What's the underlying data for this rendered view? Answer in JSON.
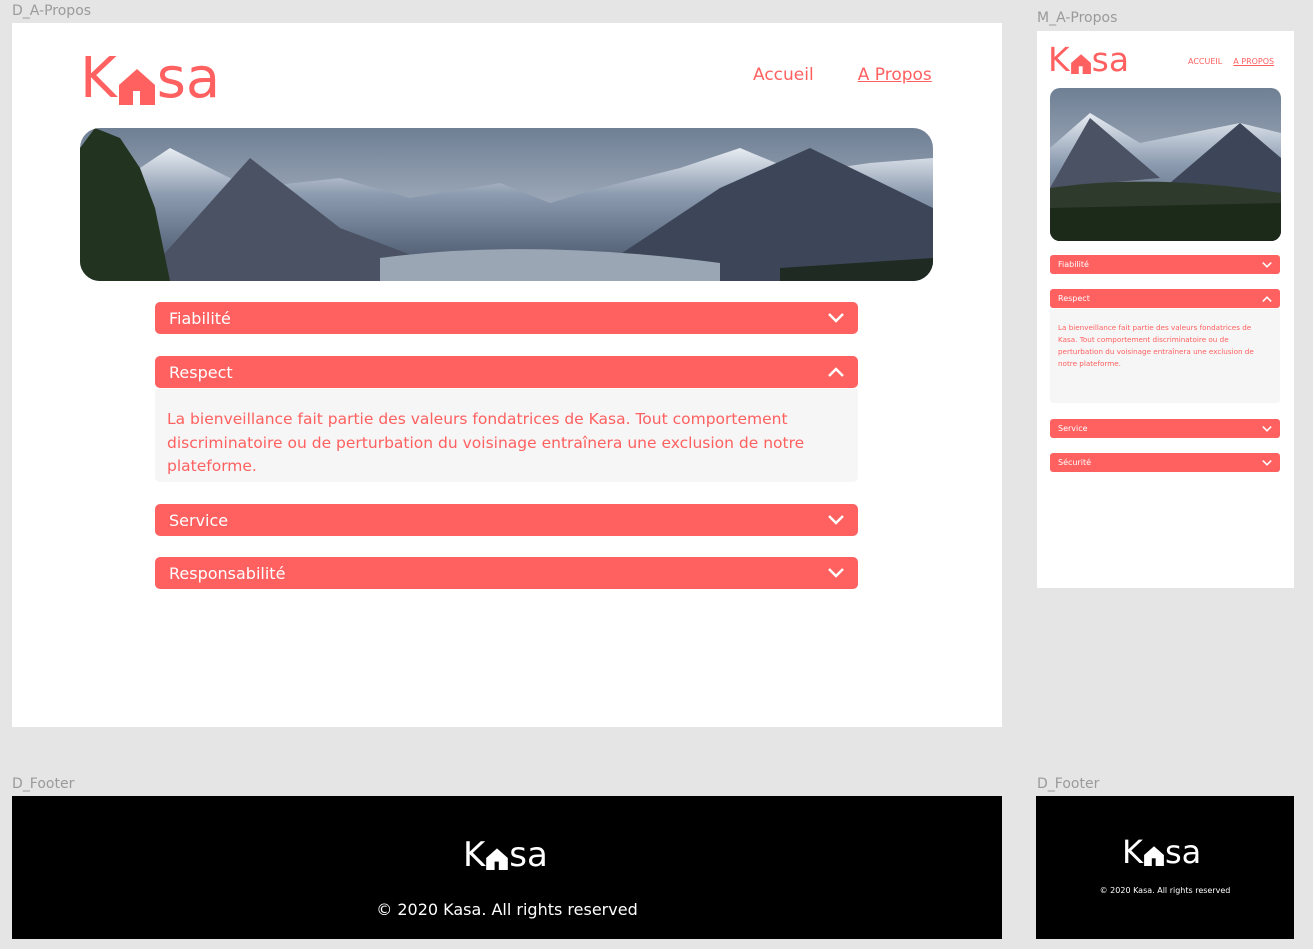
{
  "labels": {
    "desktop_about": "D_A-Propos",
    "mobile_about": "M_A-Propos",
    "desktop_footer": "D_Footer",
    "mobile_footer": "D_Footer"
  },
  "brand": {
    "before": "K",
    "after": "sa",
    "color": "#ff6060"
  },
  "desktop": {
    "nav": {
      "home": "Accueil",
      "about": "A Propos"
    },
    "accordion": [
      {
        "title": "Fiabilité",
        "open": false
      },
      {
        "title": "Respect",
        "open": true,
        "body": "La bienveillance fait partie des valeurs fondatrices de Kasa. Tout comportement discriminatoire ou de perturbation du voisinage entraînera une exclusion de notre plateforme."
      },
      {
        "title": "Service",
        "open": false
      },
      {
        "title": "Responsabilité",
        "open": false
      }
    ]
  },
  "mobile": {
    "nav": {
      "home": "ACCUEIL",
      "about": "A PROPOS"
    },
    "accordion": [
      {
        "title": "Fiabilité",
        "open": false
      },
      {
        "title": "Respect",
        "open": true,
        "body": "La bienveillance fait partie des valeurs fondatrices de Kasa. Tout comportement discriminatoire ou de perturbation du voisinage entraînera une exclusion de notre plateforme."
      },
      {
        "title": "Service",
        "open": false
      },
      {
        "title": "Sécurité",
        "open": false
      }
    ]
  },
  "footer": {
    "copyright": "© 2020 Kasa. All rights reserved"
  },
  "icons": {
    "chevron_down": "chevron-down-icon",
    "chevron_up": "chevron-up-icon",
    "house": "house-icon"
  }
}
